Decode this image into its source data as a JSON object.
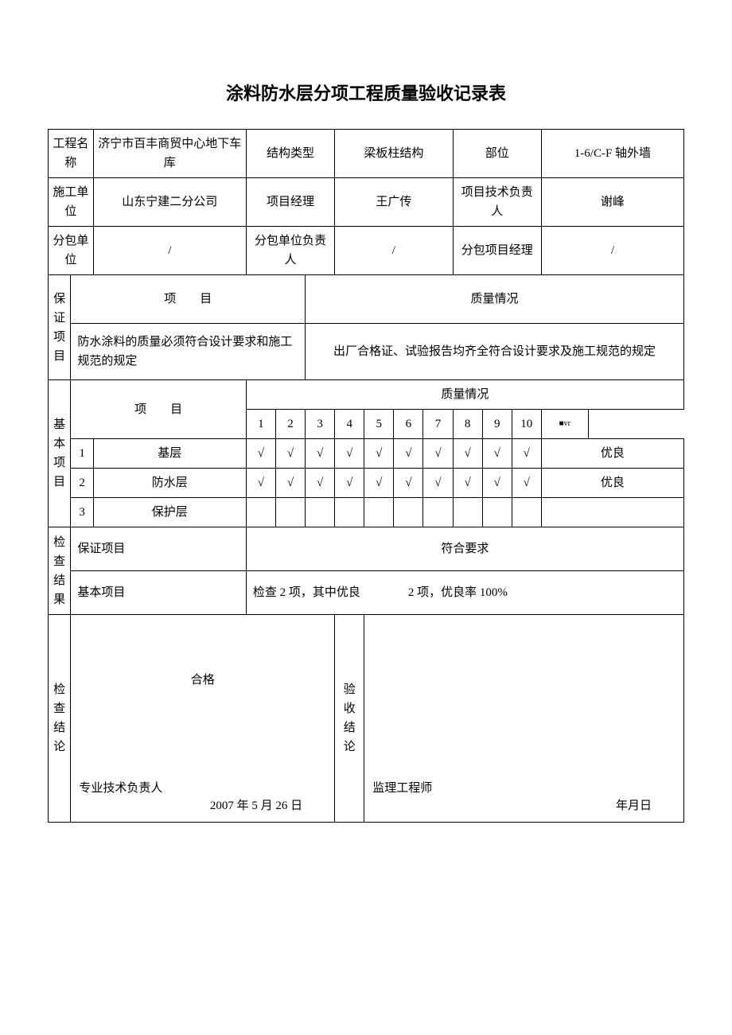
{
  "title": "涂料防水层分项工程质量验收记录表",
  "header": {
    "project_name_label": "工程名称",
    "project_name": "济宁市百丰商贸中心地下车库",
    "struct_type_label": "结构类型",
    "struct_type": "梁板柱结构",
    "part_label": "部位",
    "part": "1-6/C-F 轴外墙",
    "contractor_label": "施工单位",
    "contractor": "山东宁建二分公司",
    "pm_label": "项目经理",
    "pm": "王广传",
    "tech_lead_label": "项目技术负责人",
    "tech_lead": "谢峰",
    "sub_label": "分包单位",
    "sub": "/",
    "sub_lead_label": "分包单位负责人",
    "sub_lead": "/",
    "sub_pm_label": "分包项目经理",
    "sub_pm": "/"
  },
  "guarantee": {
    "section": "保 证项目",
    "item_header": "项　　目",
    "quality_header": "质量情况",
    "item_text": "防水涂料的质量必须符合设计要求和施工规范的规定",
    "quality_text": "出厂合格证、试验报告均齐全符合设计要求及施工规范的规定"
  },
  "basic": {
    "section": "基 本项目",
    "item_header": "项　　目",
    "quality_header": "质量情况",
    "cols": [
      "1",
      "2",
      "3",
      "4",
      "5",
      "6",
      "7",
      "8",
      "9",
      "10"
    ],
    "rating_col": "■vr",
    "rows": [
      {
        "n": "1",
        "name": "基层",
        "v": [
          "√",
          "√",
          "√",
          "√",
          "√",
          "√",
          "√",
          "√",
          "√",
          "√"
        ],
        "r": "优良"
      },
      {
        "n": "2",
        "name": "防水层",
        "v": [
          "√",
          "√",
          "√",
          "√",
          "√",
          "√",
          "√",
          "√",
          "√",
          "√"
        ],
        "r": "优良"
      },
      {
        "n": "3",
        "name": "保护层",
        "v": [
          "",
          "",
          "",
          "",
          "",
          "",
          "",
          "",
          "",
          ""
        ],
        "r": ""
      }
    ]
  },
  "check": {
    "section": "检 查结 果",
    "guarantee_label": "保证项目",
    "guarantee_val": "符合要求",
    "basic_label": "基本项目",
    "basic_val": "检查 2 项，其中优良　　　　2 项，优良率 100%"
  },
  "conclusion": {
    "check_label": "检 查结论",
    "pass": "合格",
    "sig_label": "专业技术负责人",
    "date": "2007 年 5 月 26 日",
    "accept_label": "验 收结论",
    "sup_label": "监理工程师",
    "sup_date": "年月日"
  }
}
